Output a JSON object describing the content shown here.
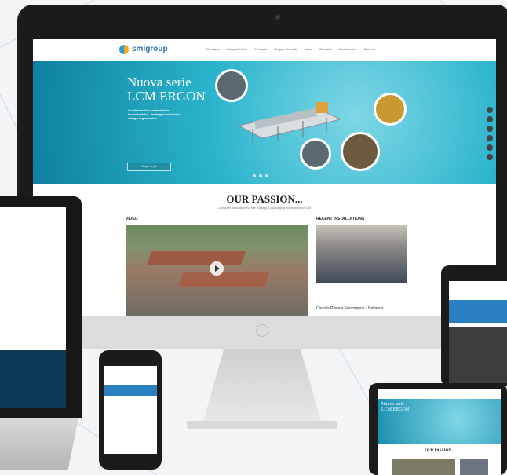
{
  "site": {
    "logo": "smigroup",
    "nav": [
      "Chi siamo",
      "Completo linee",
      "Products",
      "Gruppo Normale",
      "News",
      "Contacts",
      "Media center",
      "Careers"
    ],
    "hero": {
      "title_line1": "Nuova serie",
      "title_line2": "LCM ERGON",
      "subtitle": "Confezionatrice automatica incartonatrice. Vantaggio versatile e design ergonomico",
      "button": "Scopri di più"
    },
    "passion": {
      "heading": "OUR PASSION...",
      "subheading": "...constant innovation for the bottling & packaging industry since 1987",
      "video_label": "VIDEO",
      "installations_label": "RECENT INSTALLATIONS",
      "installation_caption": "Camilla Piovale Enrampone - Bellanco"
    }
  },
  "tablet_small": {
    "title_line1": "Nuova serie",
    "title_line2": "LCM ERGON",
    "passion": "OUR PASSION..."
  },
  "colors": {
    "hero_teal": "#2ab4cc",
    "brand_blue": "#2a7fc0",
    "device_dark": "#1b1b1b"
  }
}
